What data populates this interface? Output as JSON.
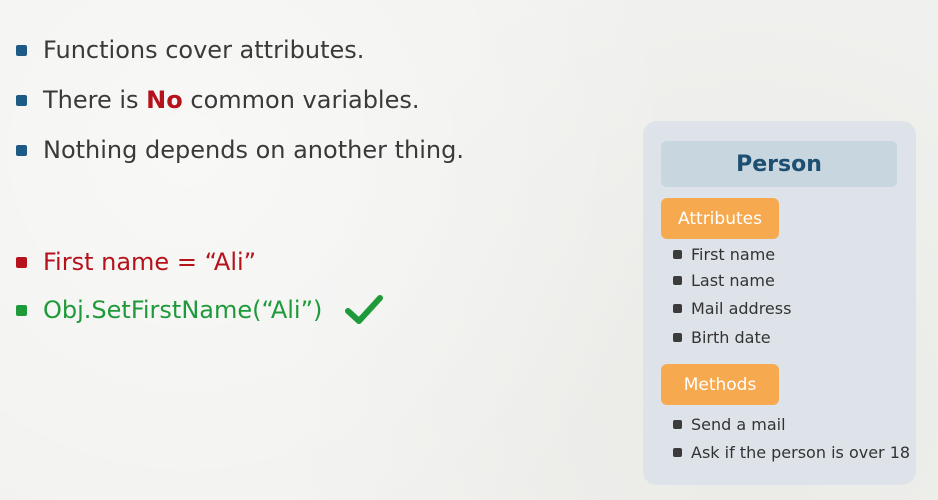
{
  "slide": {
    "points": [
      {
        "text": "Functions cover attributes."
      },
      {
        "before": "There is ",
        "emphasis": "No",
        "after": " common variables."
      },
      {
        "text": "Nothing depends on another thing."
      }
    ],
    "bad_example": "First name = “Ali”",
    "good_example": "Obj.SetFirstName(“Ali”)",
    "check_icon": "check-icon",
    "colors": {
      "blue": "#1d5b86",
      "red": "#b5121b",
      "green": "#1f9a3a",
      "orange": "#f6a94f"
    }
  },
  "card": {
    "title": "Person",
    "attributes_label": "Attributes",
    "attributes": [
      "First name",
      "Last name",
      "Mail address",
      "Birth date"
    ],
    "methods_label": "Methods",
    "methods": [
      "Send a mail",
      "Ask if the person is over 18"
    ]
  }
}
